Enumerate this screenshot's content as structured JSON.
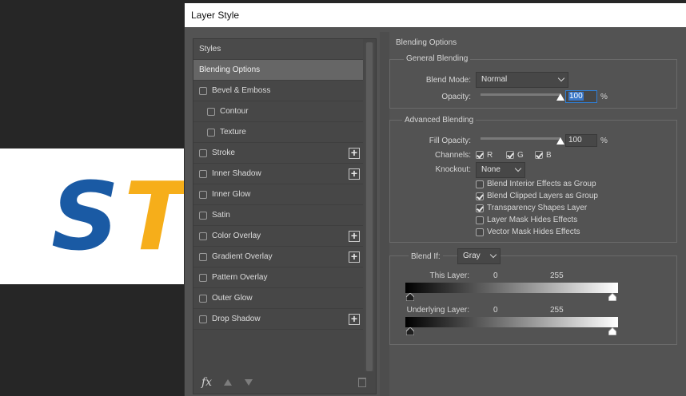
{
  "background": {
    "doc_text_1": "S",
    "doc_text_2": "T"
  },
  "dialog": {
    "title": "Layer Style"
  },
  "styles_panel": {
    "items": [
      {
        "label": "Styles",
        "checkbox": false,
        "plus": false,
        "indent": false,
        "active": false,
        "header": true
      },
      {
        "label": "Blending Options",
        "checkbox": false,
        "plus": false,
        "indent": false,
        "active": true,
        "header": false
      },
      {
        "label": "Bevel & Emboss",
        "checkbox": true,
        "plus": false,
        "indent": false,
        "active": false,
        "header": false
      },
      {
        "label": "Contour",
        "checkbox": true,
        "plus": false,
        "indent": true,
        "active": false,
        "header": false
      },
      {
        "label": "Texture",
        "checkbox": true,
        "plus": false,
        "indent": true,
        "active": false,
        "header": false
      },
      {
        "label": "Stroke",
        "checkbox": true,
        "plus": true,
        "indent": false,
        "active": false,
        "header": false
      },
      {
        "label": "Inner Shadow",
        "checkbox": true,
        "plus": true,
        "indent": false,
        "active": false,
        "header": false
      },
      {
        "label": "Inner Glow",
        "checkbox": true,
        "plus": false,
        "indent": false,
        "active": false,
        "header": false
      },
      {
        "label": "Satin",
        "checkbox": true,
        "plus": false,
        "indent": false,
        "active": false,
        "header": false
      },
      {
        "label": "Color Overlay",
        "checkbox": true,
        "plus": true,
        "indent": false,
        "active": false,
        "header": false
      },
      {
        "label": "Gradient Overlay",
        "checkbox": true,
        "plus": true,
        "indent": false,
        "active": false,
        "header": false
      },
      {
        "label": "Pattern Overlay",
        "checkbox": true,
        "plus": false,
        "indent": false,
        "active": false,
        "header": false
      },
      {
        "label": "Outer Glow",
        "checkbox": true,
        "plus": false,
        "indent": false,
        "active": false,
        "header": false
      },
      {
        "label": "Drop Shadow",
        "checkbox": true,
        "plus": true,
        "indent": false,
        "active": false,
        "header": false
      }
    ],
    "footer": {
      "fx_label": "fx"
    }
  },
  "blending": {
    "section_title": "Blending Options",
    "general": {
      "title": "General Blending",
      "blend_mode_label": "Blend Mode:",
      "blend_mode_value": "Normal",
      "opacity_label": "Opacity:",
      "opacity_value": "100",
      "opacity_unit": "%",
      "opacity_level": 1.0
    },
    "advanced": {
      "title": "Advanced Blending",
      "fill_opacity_label": "Fill Opacity:",
      "fill_opacity_value": "100",
      "fill_opacity_unit": "%",
      "fill_opacity_level": 1.0,
      "channels_label": "Channels:",
      "channels": [
        {
          "label": "R",
          "checked": true
        },
        {
          "label": "G",
          "checked": true
        },
        {
          "label": "B",
          "checked": true
        }
      ],
      "knockout_label": "Knockout:",
      "knockout_value": "None",
      "options": [
        {
          "label": "Blend Interior Effects as Group",
          "checked": false
        },
        {
          "label": "Blend Clipped Layers as Group",
          "checked": true
        },
        {
          "label": "Transparency Shapes Layer",
          "checked": true
        },
        {
          "label": "Layer Mask Hides Effects",
          "checked": false
        },
        {
          "label": "Vector Mask Hides Effects",
          "checked": false
        }
      ]
    },
    "blend_if": {
      "label": "Blend If:",
      "value": "Gray",
      "this_layer_label": "This Layer:",
      "this_layer_min": "0",
      "this_layer_max": "255",
      "underlying_label": "Underlying Layer:",
      "underlying_min": "0",
      "underlying_max": "255"
    }
  }
}
